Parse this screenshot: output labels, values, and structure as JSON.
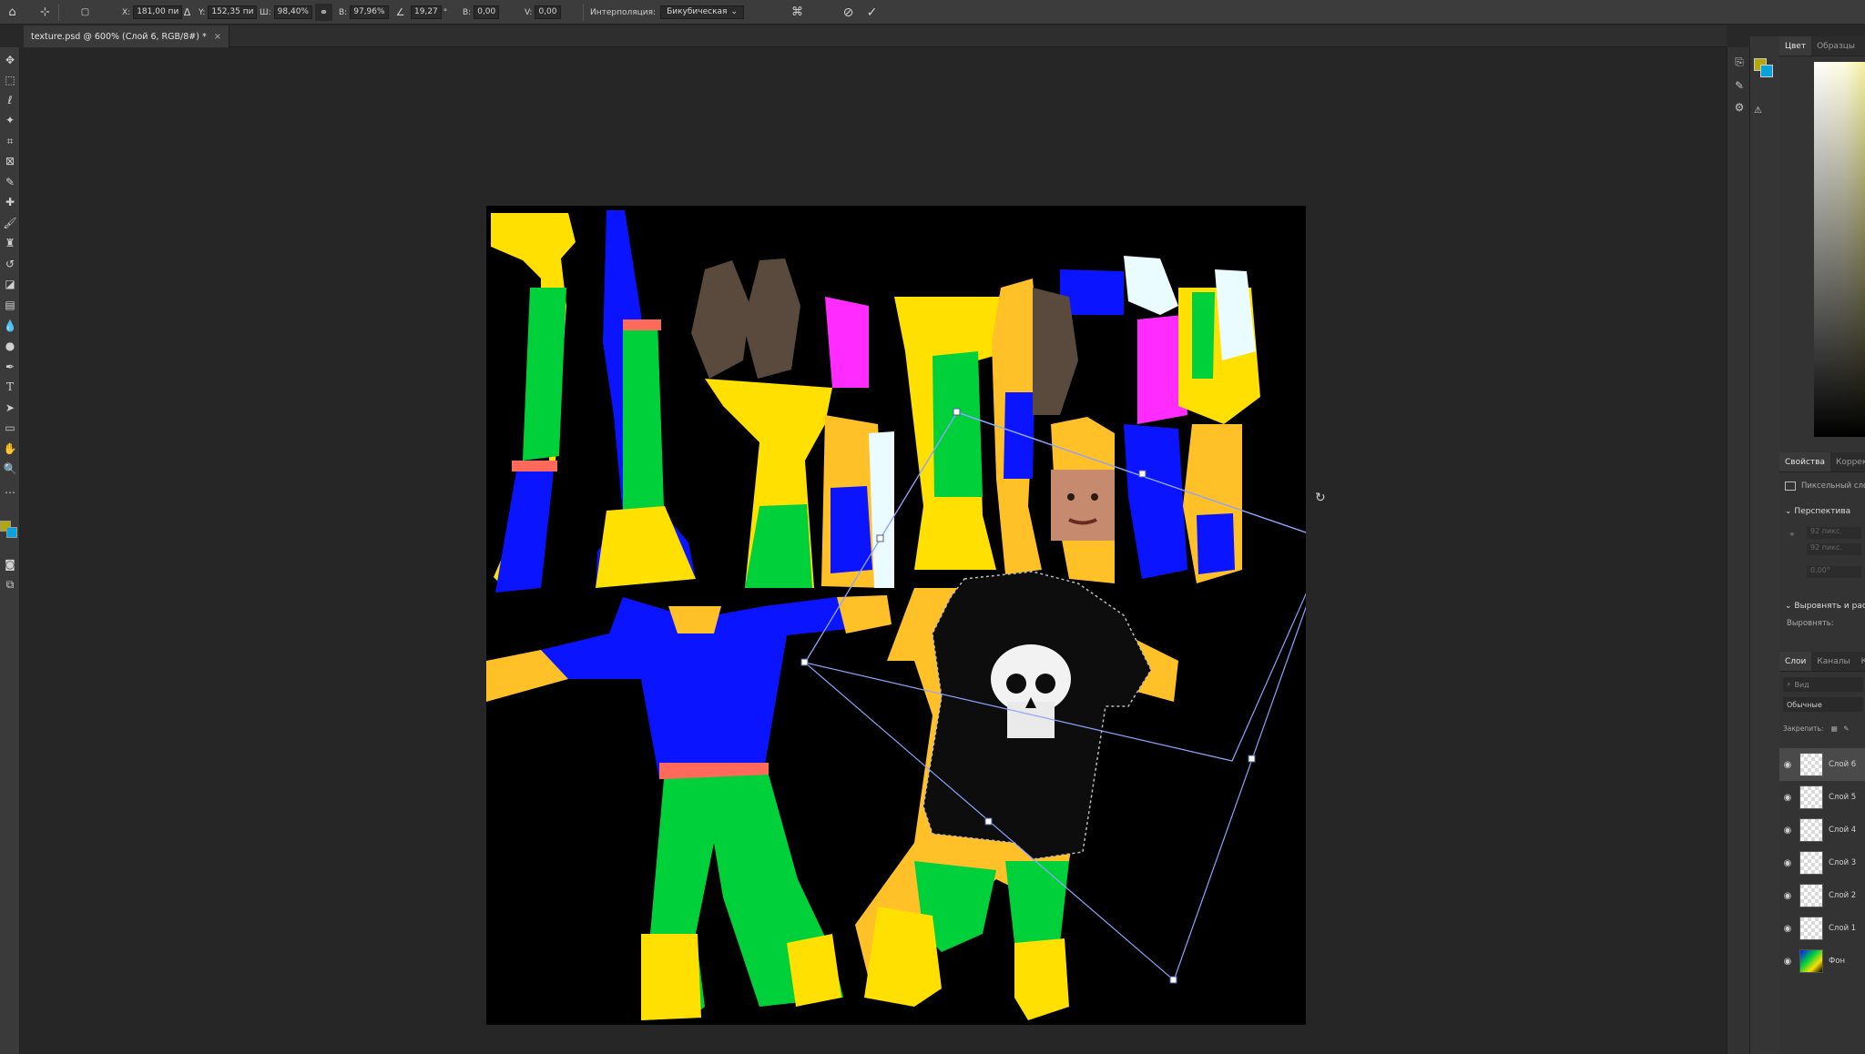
{
  "options_bar": {
    "x_label": "X:",
    "x_value": "181,00 пи",
    "y_label": "Y:",
    "y_value": "152,35 пи",
    "w_label": "Ш:",
    "w_value": "98,40%",
    "h_label": "В:",
    "h_value": "97,96%",
    "angle_value": "19,27",
    "hskew_label": "В:",
    "hskew_value": "0,00",
    "vskew_label": "V:",
    "vskew_value": "0,00",
    "interpolation_label": "Интерполяция:",
    "interpolation_value": "Бикубическая"
  },
  "document_tab": {
    "title": "texture.psd @ 600% (Слой 6, RGB/8#) *",
    "close": "×"
  },
  "color_panel": {
    "tabs": [
      "Цвет",
      "Образцы"
    ],
    "foreground": "#b5a800",
    "background": "#0aa2d8"
  },
  "properties_panel": {
    "tabs": [
      "Свойства",
      "Коррекц"
    ],
    "layer_type": "Пиксельный сло",
    "section_perspective": "Перспектива",
    "section_align": "Выровнять и рас",
    "align_label": "Выровнять:",
    "field_w": "92 пикс.",
    "field_h": "92 пикс.",
    "field_angle": "0,00°"
  },
  "layers_panel": {
    "tabs": [
      "Слои",
      "Каналы",
      "К"
    ],
    "search_placeholder": "Вид",
    "blend_mode": "Обычные",
    "lock_label": "Закрепить:",
    "layers": [
      {
        "name": "Слой 6",
        "active": true
      },
      {
        "name": "Слой 5",
        "active": false
      },
      {
        "name": "Слой 4",
        "active": false
      },
      {
        "name": "Слой 3",
        "active": false
      },
      {
        "name": "Слой 2",
        "active": false
      },
      {
        "name": "Слой 1",
        "active": false
      },
      {
        "name": "Фон",
        "active": false
      }
    ]
  },
  "colors": {
    "yellow": "#ffe000",
    "orange": "#ffc028",
    "green": "#00d13a",
    "blue": "#0a14ff",
    "magenta": "#ff2bff",
    "salmon": "#ff6a5a",
    "white": "#eafcff",
    "selection": "#8fa3ff"
  }
}
